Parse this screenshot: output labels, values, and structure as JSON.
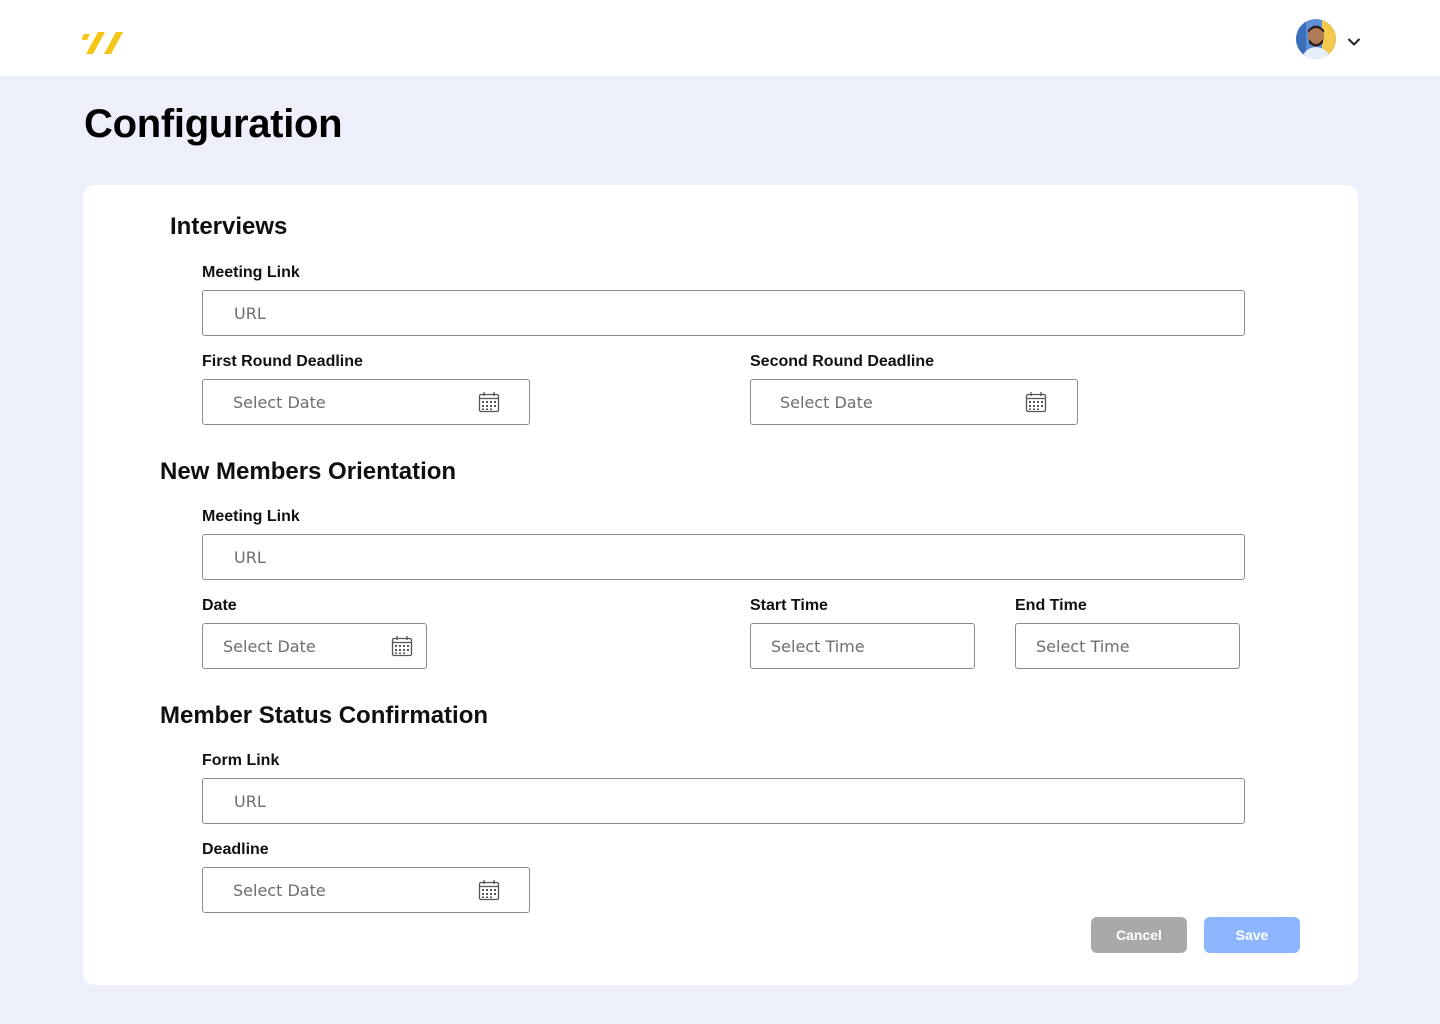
{
  "header": {
    "logo_icon": "brand-slashes-icon",
    "logo_color": "#f5c518",
    "avatar_icon": "user-avatar",
    "menu_icon": "chevron-down-icon"
  },
  "page": {
    "title": "Configuration"
  },
  "interviews": {
    "title": "Interviews",
    "meeting_link_label": "Meeting Link",
    "meeting_link_placeholder": "URL",
    "first_round_label": "First Round Deadline",
    "first_round_placeholder": "Select Date",
    "second_round_label": "Second Round Deadline",
    "second_round_placeholder": "Select Date"
  },
  "orientation": {
    "title": "New Members Orientation",
    "meeting_link_label": "Meeting Link",
    "meeting_link_placeholder": "URL",
    "date_label": "Date",
    "date_placeholder": "Select Date",
    "start_time_label": "Start Time",
    "start_time_placeholder": "Select Time",
    "end_time_label": "End Time",
    "end_time_placeholder": "Select Time"
  },
  "status_confirmation": {
    "title": "Member Status Confirmation",
    "form_link_label": "Form Link",
    "form_link_placeholder": "URL",
    "deadline_label": "Deadline",
    "deadline_placeholder": "Select Date"
  },
  "actions": {
    "cancel_label": "Cancel",
    "save_label": "Save",
    "cancel_color": "#a9a9a9",
    "save_color": "#8cb6ff"
  }
}
